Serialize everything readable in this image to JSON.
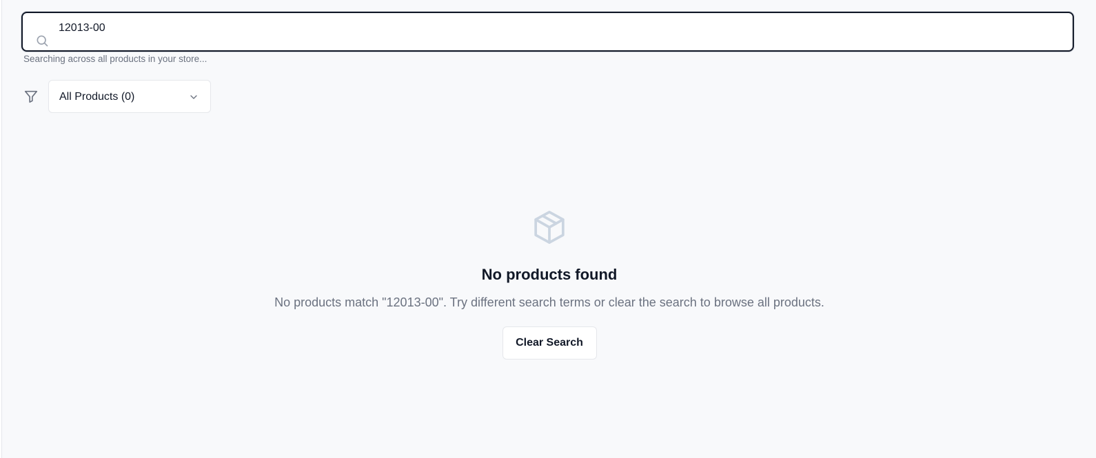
{
  "search": {
    "value": "12013-00",
    "icon": "search-icon",
    "helper_text": "Searching across all products in your store..."
  },
  "filter": {
    "icon": "filter-icon",
    "selected_label": "All Products (0)",
    "chevron_icon": "chevron-down-icon"
  },
  "empty_state": {
    "icon": "box-icon",
    "title": "No products found",
    "description": "No products match \"12013-00\". Try different search terms or clear the search to browse all products.",
    "clear_button_label": "Clear Search"
  },
  "colors": {
    "background": "#f8f9fb",
    "focus_border": "#111827",
    "muted_text": "#6b7280",
    "icon_gray": "#cbd5e1"
  }
}
